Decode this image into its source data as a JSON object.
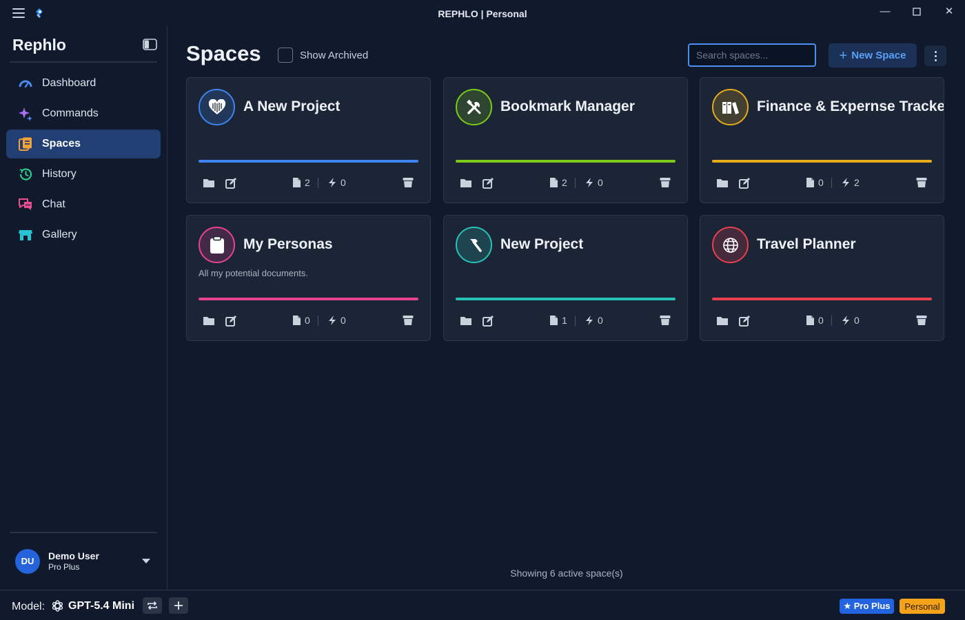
{
  "window": {
    "title": "REPHLO | Personal"
  },
  "sidebar": {
    "brand": "Rephlo",
    "items": [
      {
        "label": "Dashboard",
        "icon": "gauge-icon",
        "color": "#4a8cf0"
      },
      {
        "label": "Commands",
        "icon": "sparkle-icon",
        "color": "#a872f5"
      },
      {
        "label": "Spaces",
        "icon": "spaces-icon",
        "color": "#f2a23a",
        "active": true
      },
      {
        "label": "History",
        "icon": "history-icon",
        "color": "#2fcb8a"
      },
      {
        "label": "Chat",
        "icon": "chat-icon",
        "color": "#ea4f8f"
      },
      {
        "label": "Gallery",
        "icon": "store-icon",
        "color": "#28c3d2"
      }
    ],
    "user": {
      "initials": "DU",
      "name": "Demo User",
      "plan": "Pro Plus"
    }
  },
  "header": {
    "title": "Spaces",
    "show_archived": "Show Archived",
    "search_placeholder": "Search spaces...",
    "new_space": "New Space"
  },
  "spaces": [
    {
      "title": "A New Project",
      "description": "",
      "color": "#3f85f2",
      "icon": "heart-icon",
      "files": "2",
      "commands": "0"
    },
    {
      "title": "Bookmark Manager",
      "description": "",
      "color": "#7ccb1a",
      "icon": "tools-icon",
      "files": "2",
      "commands": "0"
    },
    {
      "title": "Finance & Expernse Tracker",
      "description": "",
      "color": "#e6ac1c",
      "icon": "books-icon",
      "files": "0",
      "commands": "2"
    },
    {
      "title": "My Personas",
      "description": "All my potential documents.",
      "color": "#e8438f",
      "icon": "clipboard-icon",
      "files": "0",
      "commands": "0"
    },
    {
      "title": "New Project",
      "description": "",
      "color": "#27c3b6",
      "icon": "hammer-icon",
      "files": "1",
      "commands": "0"
    },
    {
      "title": "Travel Planner",
      "description": "",
      "color": "#e9404f",
      "icon": "globe-icon",
      "files": "0",
      "commands": "0"
    }
  ],
  "footer": {
    "status": "Showing 6 active space(s)"
  },
  "statusbar": {
    "model_label": "Model:",
    "model_name": "GPT-5.4 Mini",
    "tier_badge": "★ Pro Plus",
    "profile_badge": "Personal"
  }
}
